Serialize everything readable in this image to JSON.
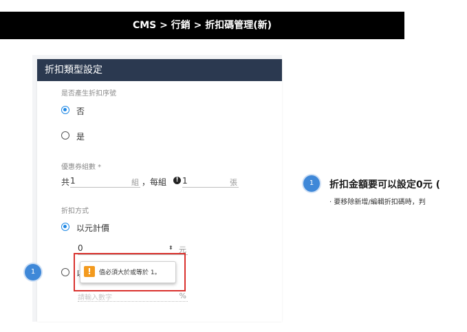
{
  "header": {
    "title": "CMS > 行銷 > 折扣碼管理(新)"
  },
  "card": {
    "title": "折扣類型設定"
  },
  "serial": {
    "label": "是否產生折扣序號",
    "options": [
      {
        "label": "否",
        "selected": true
      },
      {
        "label": "是",
        "selected": false
      }
    ]
  },
  "groups": {
    "label": "優惠券組數 *",
    "prefix": "共",
    "count_value": "1",
    "count_unit": "組",
    "per_group_label": "，每組",
    "per_group_icon": "!",
    "per_group_value": "1",
    "per_group_unit": "張"
  },
  "discount": {
    "label": "折扣方式",
    "option1_label": "以元計價",
    "amount_value": "0",
    "amount_unit": "元",
    "option2_partial": "以",
    "percent_placeholder": "請輸入數字",
    "percent_unit": "%"
  },
  "validation": {
    "message": "值必須大於或等於 1。",
    "icon": "!"
  },
  "callouts": [
    {
      "number": "1"
    },
    {
      "number": "1",
      "title": "折扣金額要可以設定0元 (",
      "subtitle": "· 要移除新增/編輯折扣碼時，判"
    }
  ],
  "colors": {
    "accent": "#1e88e5",
    "header_bg": "#2b3950",
    "warning": "#f39a1e",
    "highlight": "#d9302c",
    "badge": "#3f88d8"
  }
}
